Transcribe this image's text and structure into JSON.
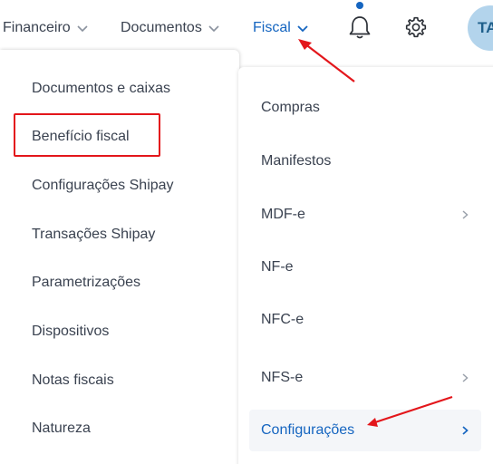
{
  "topnav": {
    "items": [
      {
        "label": "Financeiro"
      },
      {
        "label": "Documentos"
      },
      {
        "label": "Fiscal"
      }
    ],
    "avatar_initials": "TA",
    "active_color": "#1565c0"
  },
  "left_menu": {
    "items": [
      {
        "label": "Documentos e caixas"
      },
      {
        "label": "Benefício fiscal"
      },
      {
        "label": "Configurações Shipay"
      },
      {
        "label": "Transações Shipay"
      },
      {
        "label": "Parametrizações"
      },
      {
        "label": "Dispositivos"
      },
      {
        "label": "Notas fiscais"
      },
      {
        "label": "Natureza"
      }
    ]
  },
  "right_menu": {
    "items": [
      {
        "label": "Compras",
        "has_submenu": false
      },
      {
        "label": "Manifestos",
        "has_submenu": false
      },
      {
        "label": "MDF-e",
        "has_submenu": true
      },
      {
        "label": "NF-e",
        "has_submenu": false
      },
      {
        "label": "NFC-e",
        "has_submenu": false
      },
      {
        "label": "NFS-e",
        "has_submenu": true
      },
      {
        "label": "Configurações",
        "has_submenu": true,
        "active": true
      }
    ]
  },
  "annotations": {
    "highlight_color": "#e3161b",
    "highlighted_item": "Benefício fiscal"
  }
}
